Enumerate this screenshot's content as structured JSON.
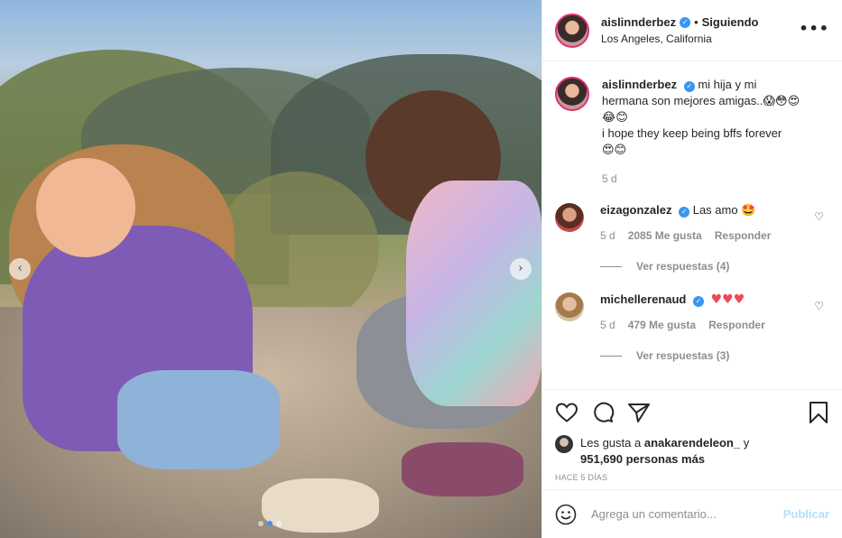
{
  "post": {
    "username": "aislinnderbez",
    "follow_status": "Siguiendo",
    "location": "Los Angeles, California",
    "caption_line1": "mi hija y mi hermana son mejores amigas..😱😳😍😂😊",
    "caption_line2": "i hope they keep being bffs forever",
    "caption_line3": "😍😊",
    "time": "5 d"
  },
  "comments": [
    {
      "username": "eizagonzalez",
      "text": "Las amo 🤩",
      "time": "5 d",
      "likes": "2085 Me gusta",
      "reply": "Responder",
      "view_replies": "Ver respuestas (4)"
    },
    {
      "username": "michellerenaud",
      "text": "♥♥♥",
      "time": "5 d",
      "likes": "479 Me gusta",
      "reply": "Responder",
      "view_replies": "Ver respuestas (3)"
    }
  ],
  "likes": {
    "prefix": "Les gusta a",
    "user": "anakarendeleon_",
    "conj": "y",
    "count": "951,690 personas más"
  },
  "posted_ago": "HACE 5 DÍAS",
  "comment_box": {
    "placeholder": "Agrega un comentario...",
    "publish": "Publicar"
  },
  "icons": {
    "verified": "verified-badge-icon",
    "more": "more-options-icon",
    "like": "heart-outline-icon",
    "comment": "comment-bubble-icon",
    "share": "paper-plane-icon",
    "save": "bookmark-icon",
    "emoji": "smiley-icon"
  },
  "carousel": {
    "slide_count": 3,
    "active_index": 1
  },
  "colors": {
    "verified": "#3897f0",
    "publish_disabled": "#b2dffc",
    "muted": "#8e8e8e",
    "heart_red": "#ed4956"
  }
}
